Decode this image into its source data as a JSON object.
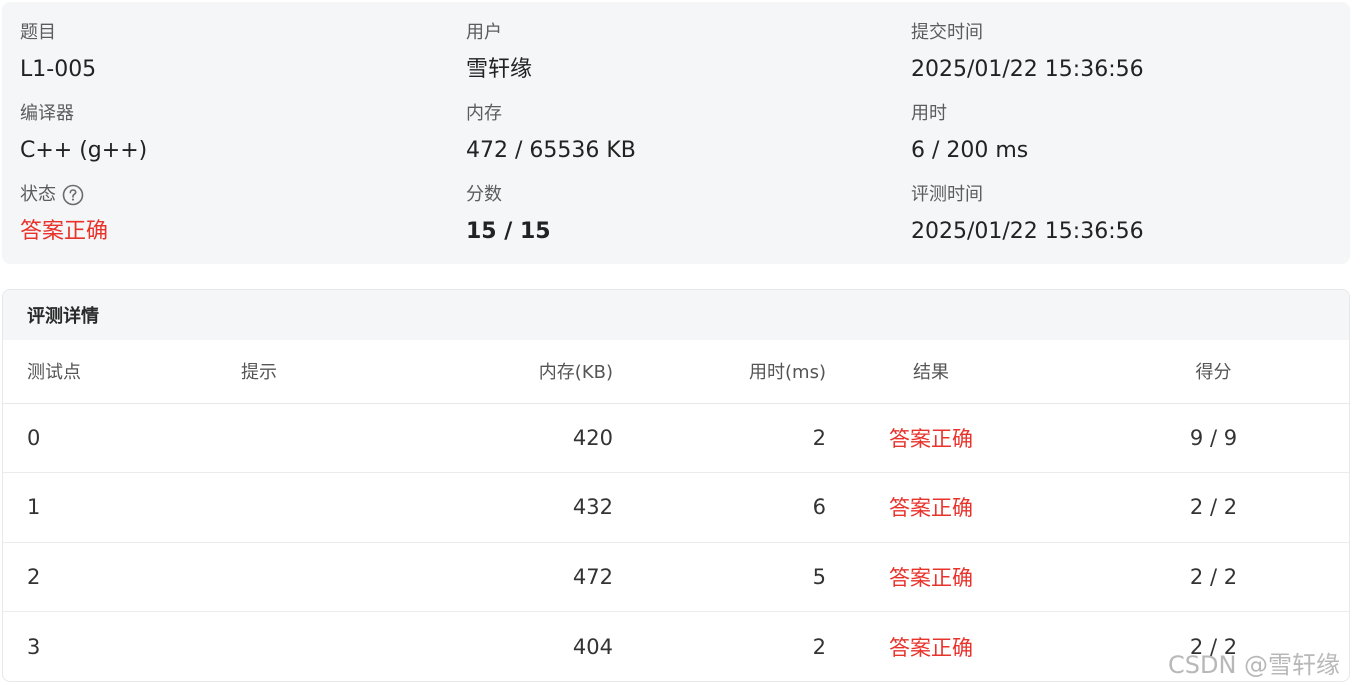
{
  "summary": {
    "problem": {
      "label": "题目",
      "value": "L1-005"
    },
    "user": {
      "label": "用户",
      "value": "雪轩缘"
    },
    "submit_time": {
      "label": "提交时间",
      "value": "2025/01/22 15:36:56"
    },
    "compiler": {
      "label": "编译器",
      "value": "C++ (g++)"
    },
    "memory": {
      "label": "内存",
      "value": "472 / 65536 KB"
    },
    "time_used": {
      "label": "用时",
      "value": "6 / 200 ms"
    },
    "status": {
      "label": "状态",
      "value": "答案正确"
    },
    "score": {
      "label": "分数",
      "value": "15 / 15"
    },
    "judge_time": {
      "label": "评测时间",
      "value": "2025/01/22 15:36:56"
    }
  },
  "detail": {
    "title": "评测详情",
    "columns": {
      "point": "测试点",
      "hint": "提示",
      "memory": "内存(KB)",
      "time": "用时(ms)",
      "result": "结果",
      "score": "得分"
    },
    "rows": [
      {
        "point": "0",
        "hint": "",
        "memory": "420",
        "time": "2",
        "result": "答案正确",
        "score": "9 / 9"
      },
      {
        "point": "1",
        "hint": "",
        "memory": "432",
        "time": "6",
        "result": "答案正确",
        "score": "2 / 2"
      },
      {
        "point": "2",
        "hint": "",
        "memory": "472",
        "time": "5",
        "result": "答案正确",
        "score": "2 / 2"
      },
      {
        "point": "3",
        "hint": "",
        "memory": "404",
        "time": "2",
        "result": "答案正确",
        "score": "2 / 2"
      }
    ]
  },
  "watermark": "CSDN @雪轩缘",
  "colors": {
    "accepted": "#e8332b",
    "card_bg": "#f5f6f8"
  },
  "icons": {
    "status_help": "question-circle-icon"
  }
}
